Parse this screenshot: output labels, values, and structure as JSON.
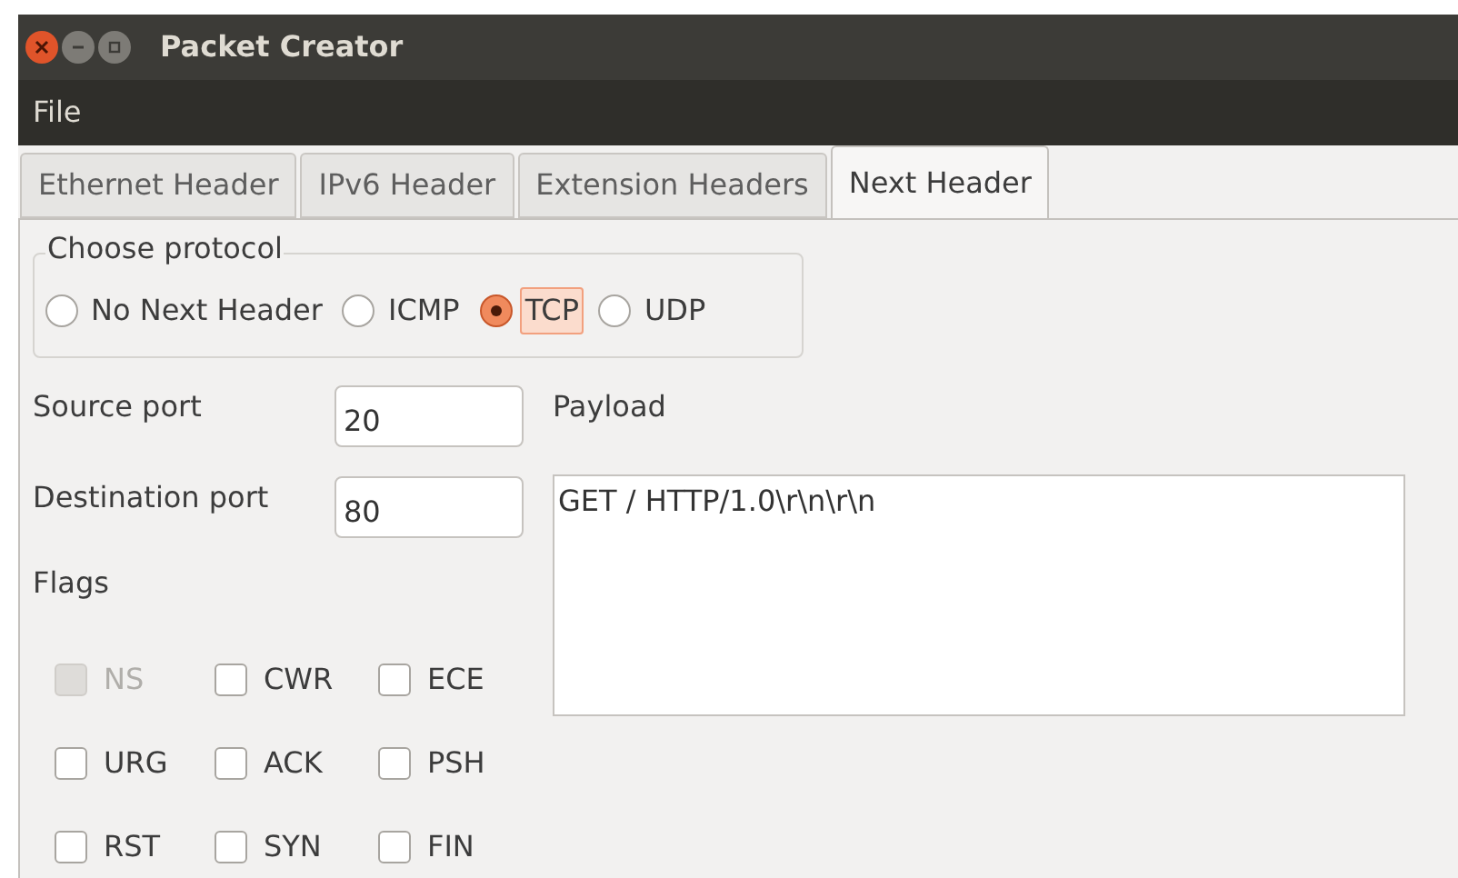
{
  "window": {
    "title": "Packet Creator"
  },
  "menu": [
    "File"
  ],
  "tabs": [
    {
      "label": "Ethernet Header",
      "selected": false
    },
    {
      "label": "IPv6 Header",
      "selected": false
    },
    {
      "label": "Extension Headers",
      "selected": false
    },
    {
      "label": "Next Header",
      "selected": true
    }
  ],
  "protocol_group": {
    "title": "Choose protocol",
    "options": [
      {
        "label": "No Next Header",
        "selected": false,
        "focused": false
      },
      {
        "label": "ICMP",
        "selected": false,
        "focused": false
      },
      {
        "label": "TCP",
        "selected": true,
        "focused": true
      },
      {
        "label": "UDP",
        "selected": false,
        "focused": false
      }
    ]
  },
  "ports": [
    {
      "label": "Source port",
      "value": "20"
    },
    {
      "label": "Destination port",
      "value": "80"
    }
  ],
  "flags": {
    "title": "Flags",
    "items": [
      {
        "label": "NS",
        "checked": false,
        "disabled": true
      },
      {
        "label": "CWR",
        "checked": false,
        "disabled": false
      },
      {
        "label": "ECE",
        "checked": false,
        "disabled": false
      },
      {
        "label": "URG",
        "checked": false,
        "disabled": false
      },
      {
        "label": "ACK",
        "checked": false,
        "disabled": false
      },
      {
        "label": "PSH",
        "checked": false,
        "disabled": false
      },
      {
        "label": "RST",
        "checked": false,
        "disabled": false
      },
      {
        "label": "SYN",
        "checked": false,
        "disabled": false
      },
      {
        "label": "FIN",
        "checked": false,
        "disabled": false
      }
    ]
  },
  "payload": {
    "label": "Payload",
    "value": "GET / HTTP/1.0\\r\\n\\r\\n"
  }
}
